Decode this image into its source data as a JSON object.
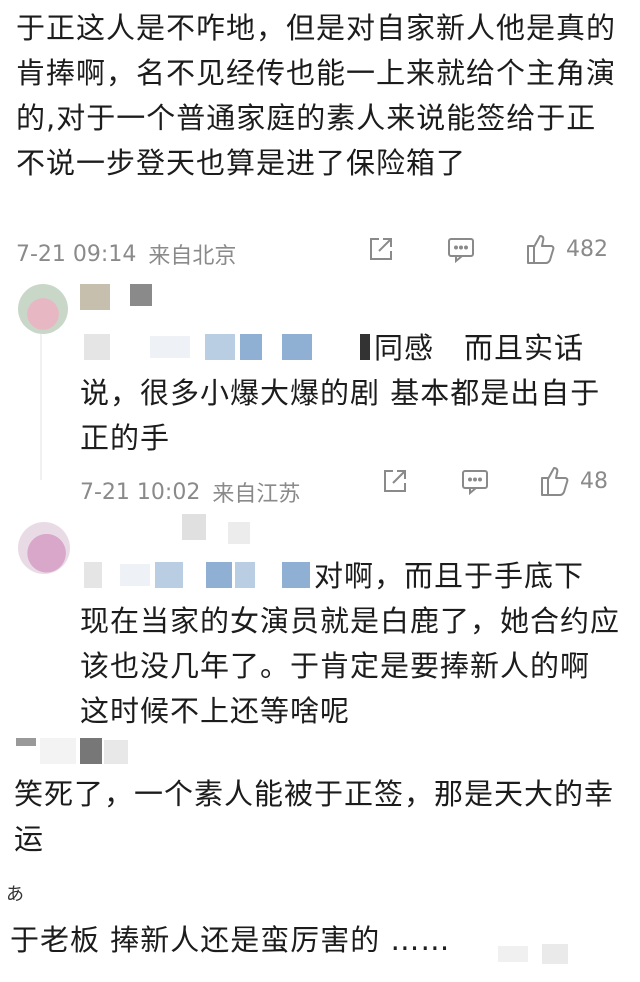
{
  "main_comment": {
    "text": "于正这人是不咋地，但是对自家新人他是真的肯捧啊，名不见经传也能一上来就给个主角演的,对于一个普通家庭的素人来说能签给于正不说一步登天也算是进了保险箱了",
    "time": "7-21 09:14",
    "location": "来自北京",
    "like_count": "482"
  },
  "reply1": {
    "text_line1": "同感　而且实话",
    "text_rest": "说，很多小爆大爆的剧 基本都是出自于正的手",
    "time": "7-21 10:02",
    "location": "来自江苏",
    "like_count": "48"
  },
  "reply2": {
    "text_line1": "对啊，而且于手底下",
    "text_rest": "现在当家的女演员就是白鹿了，她合约应该也没几年了。于肯定是要捧新人的啊　这时候不上还等啥呢"
  },
  "comment3": {
    "text": "笑死了，一个素人能被于正签，那是天大的幸运"
  },
  "comment4": {
    "partial_char": "あ",
    "text": "于老板 捧新人还是蛮厉害的 ……"
  },
  "icons": {
    "share": "share-icon",
    "comment": "comment-icon",
    "like": "thumbs-up-icon"
  }
}
